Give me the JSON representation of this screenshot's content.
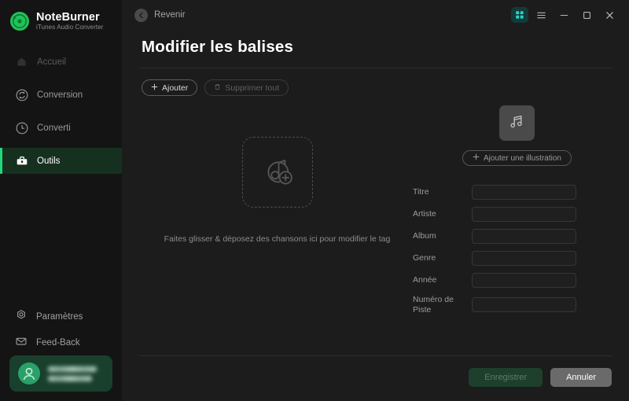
{
  "brand": {
    "name": "NoteBurner",
    "subtitle": "iTunes Audio Converter",
    "logo_icon": "disc-logo-icon"
  },
  "colors": {
    "accent_green": "#21d97a",
    "active_bg": "#16301f",
    "teal": "#2ad4c8",
    "sidebar_bg": "#141414",
    "main_bg": "#1c1c1c"
  },
  "sidebar": {
    "items": [
      {
        "label": "Accueil",
        "icon": "home-icon",
        "state": "dim"
      },
      {
        "label": "Conversion",
        "icon": "convert-icon",
        "state": "normal"
      },
      {
        "label": "Converti",
        "icon": "clock-icon",
        "state": "normal"
      },
      {
        "label": "Outils",
        "icon": "toolbox-icon",
        "state": "active"
      }
    ],
    "bottom_items": [
      {
        "label": "Paramètres",
        "icon": "gear-icon"
      },
      {
        "label": "Feed-Back",
        "icon": "envelope-icon"
      }
    ],
    "account": {
      "avatar_icon": "user-avatar-icon",
      "name_redacted": true,
      "email_redacted": true
    }
  },
  "topbar": {
    "back_label": "Revenir",
    "back_icon": "arrow-left-circle-icon",
    "window_controls": [
      {
        "name": "grid-view-icon",
        "state": "active"
      },
      {
        "name": "menu-icon",
        "state": "normal"
      },
      {
        "name": "minimize-icon",
        "state": "normal"
      },
      {
        "name": "maximize-icon",
        "state": "normal"
      },
      {
        "name": "close-icon",
        "state": "normal"
      }
    ]
  },
  "page": {
    "title": "Modifier les balises",
    "toolbar": {
      "add_label": "Ajouter",
      "add_icon": "plus-icon",
      "delete_all_label": "Supprimer tout",
      "delete_all_icon": "trash-icon",
      "delete_all_disabled": true
    },
    "dropzone": {
      "icon": "music-note-add-icon",
      "text": "Faites glisser & déposez des chansons ici pour modifier le tag"
    },
    "artwork": {
      "placeholder_icon": "music-note-icon",
      "add_label": "Ajouter une illustration",
      "add_icon": "plus-icon"
    },
    "fields": [
      {
        "label": "Titre",
        "value": "",
        "name": "titre-input"
      },
      {
        "label": "Artiste",
        "value": "",
        "name": "artiste-input"
      },
      {
        "label": "Album",
        "value": "",
        "name": "album-input"
      },
      {
        "label": "Genre",
        "value": "",
        "name": "genre-input"
      },
      {
        "label": "Année",
        "value": "",
        "name": "annee-input"
      },
      {
        "label": "Numéro de Piste",
        "value": "",
        "name": "numero-de-piste-input"
      }
    ],
    "footer": {
      "save_label": "Enregistrer",
      "save_disabled": true,
      "cancel_label": "Annuler"
    }
  }
}
